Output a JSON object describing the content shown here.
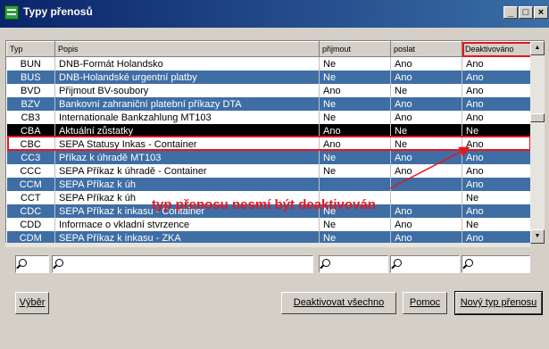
{
  "window": {
    "title": "Typy přenosů",
    "controls": [
      "_",
      "□",
      "×"
    ]
  },
  "table": {
    "columns": [
      "Typ",
      "Popis",
      "přijmout",
      "poslat",
      "Deaktivováno"
    ],
    "rows": [
      {
        "typ": "BUN",
        "popis": "DNB-Formát Holandsko",
        "prijmout": "Ne",
        "poslat": "Ano",
        "deaktivovano": "Ano"
      },
      {
        "typ": "BUS",
        "popis": "DNB-Holandské urgentní platby",
        "prijmout": "Ne",
        "poslat": "Ano",
        "deaktivovano": "Ano"
      },
      {
        "typ": "BVD",
        "popis": "Přijmout BV-soubory",
        "prijmout": "Ano",
        "poslat": "Ne",
        "deaktivovano": "Ano"
      },
      {
        "typ": "BZV",
        "popis": "Bankovní zahraniční platební příkazy DTA",
        "prijmout": "Ne",
        "poslat": "Ano",
        "deaktivovano": "Ano"
      },
      {
        "typ": "CB3",
        "popis": "Internationale Bankzahlung MT103",
        "prijmout": "Ne",
        "poslat": "Ano",
        "deaktivovano": "Ano"
      },
      {
        "typ": "CBA",
        "popis": "Aktuální zůstatky",
        "prijmout": "Ano",
        "poslat": "Ne",
        "deaktivovano": "Ne"
      },
      {
        "typ": "CBC",
        "popis": "SEPA Statusy Inkas - Container",
        "prijmout": "Ano",
        "poslat": "Ne",
        "deaktivovano": "Ano"
      },
      {
        "typ": "CC3",
        "popis": "Příkaz k úhradě MT103",
        "prijmout": "Ne",
        "poslat": "Ano",
        "deaktivovano": "Ano"
      },
      {
        "typ": "CCC",
        "popis": "SEPA Příkaz k úhradě - Container",
        "prijmout": "Ne",
        "poslat": "Ano",
        "deaktivovano": "Ano"
      },
      {
        "typ": "CCM",
        "popis": "SEPA Příkaz k úh",
        "prijmout": "",
        "poslat": "",
        "deaktivovano": "Ano"
      },
      {
        "typ": "CCT",
        "popis": "SEPA Příkaz k úh",
        "prijmout": "",
        "poslat": "",
        "deaktivovano": "Ne"
      },
      {
        "typ": "CDC",
        "popis": "SEPA Příkaz k inkasu - Container",
        "prijmout": "Ne",
        "poslat": "Ano",
        "deaktivovano": "Ano"
      },
      {
        "typ": "CDD",
        "popis": "Informace o vkladní stvrzence",
        "prijmout": "Ne",
        "poslat": "Ano",
        "deaktivovano": "Ne"
      },
      {
        "typ": "CDM",
        "popis": "SEPA Příkaz k inkasu - ZKA",
        "prijmout": "Ne",
        "poslat": "Ano",
        "deaktivovano": "Ano"
      }
    ],
    "selected_row": 5,
    "highlighted_column": 4
  },
  "annotation": "typ přenosu nesmí být deaktivován",
  "buttons": {
    "vyber": "Výběr",
    "deactivate_all": "Deaktivovat všechno",
    "help": "Pomoc",
    "new_type": "Nový typ přenosu"
  },
  "colors": {
    "title_bar": "#0a246a",
    "row_blue": "#3f6ea4",
    "selected": "#000000",
    "annotation": "#e8141e"
  }
}
